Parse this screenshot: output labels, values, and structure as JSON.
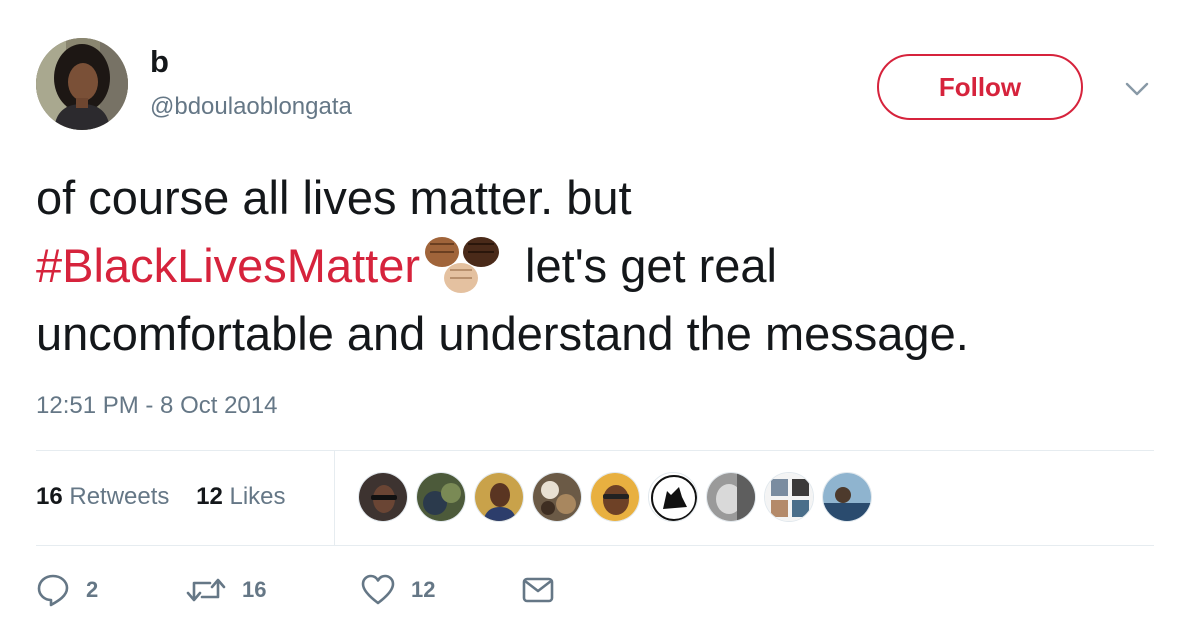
{
  "user": {
    "display_name": "b",
    "handle": "@bdoulaoblongata",
    "avatar_icon": "profile-photo"
  },
  "follow_label": "Follow",
  "tweet": {
    "line1": "of course all lives matter. but",
    "hashtag": "#BlackLivesMatter",
    "emoji": "raised-fists-three-skin-tones",
    "line2_rest": " let's get real",
    "line3": "uncomfortable and understand the message."
  },
  "timestamp": "12:51 PM - 8 Oct 2014",
  "stats": {
    "retweets_count": "16",
    "retweets_label": "Retweets",
    "likes_count": "12",
    "likes_label": "Likes"
  },
  "actions": {
    "reply_count": "2",
    "retweet_count": "16",
    "like_count": "12"
  },
  "colors": {
    "accent": "#d6233c",
    "secondary_text": "#657786",
    "divider": "#e6ecf0"
  }
}
